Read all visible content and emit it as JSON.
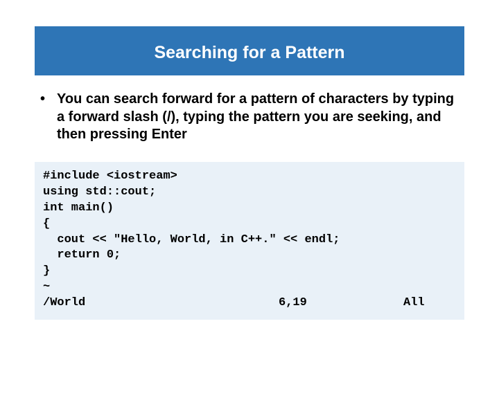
{
  "title": "Searching for a Pattern",
  "bullet": {
    "prefix": "You can search forward for a pattern of characters by typing a forward slash (",
    "slash": "/",
    "mid": "), typing the pattern you are seeking, and then pressing ",
    "enter": "Enter"
  },
  "code": {
    "l1": "#include <iostream>",
    "l2": "using std::cout;",
    "l3": "int main()",
    "l4": "{",
    "l5": "  cout << \"Hello, World, in C++.\" << endl;",
    "l6": "  return 0;",
    "l7": "}",
    "l8": "~",
    "status_left": "/World",
    "status_mid": "6,19",
    "status_right": "All"
  }
}
